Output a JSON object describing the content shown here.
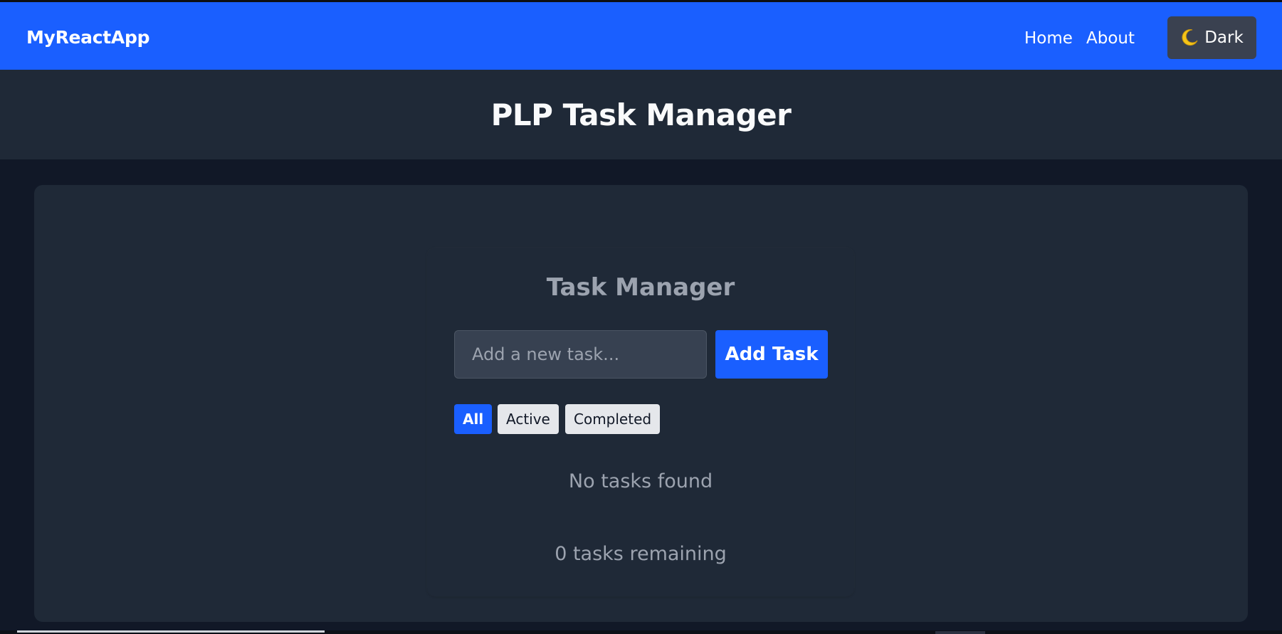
{
  "navbar": {
    "brand": "MyReactApp",
    "links": [
      {
        "label": "Home"
      },
      {
        "label": "About"
      }
    ],
    "theme_toggle": {
      "icon": "crescent-moon-icon",
      "label": "Dark"
    }
  },
  "header": {
    "title": "PLP Task Manager"
  },
  "task_manager": {
    "title": "Task Manager",
    "input": {
      "placeholder": "Add a new task...",
      "value": ""
    },
    "add_button": "Add Task",
    "filters": [
      {
        "label": "All",
        "selected": true
      },
      {
        "label": "Active",
        "selected": false
      },
      {
        "label": "Completed",
        "selected": false
      }
    ],
    "empty_message": "No tasks found",
    "remaining_text": "0 tasks remaining"
  },
  "colors": {
    "primary": "#1a5fff",
    "page_background": "#111827",
    "panel_background": "#1f2937",
    "input_background": "#374151",
    "muted_text": "#9ca3af",
    "chip_background": "#e5e7eb"
  }
}
